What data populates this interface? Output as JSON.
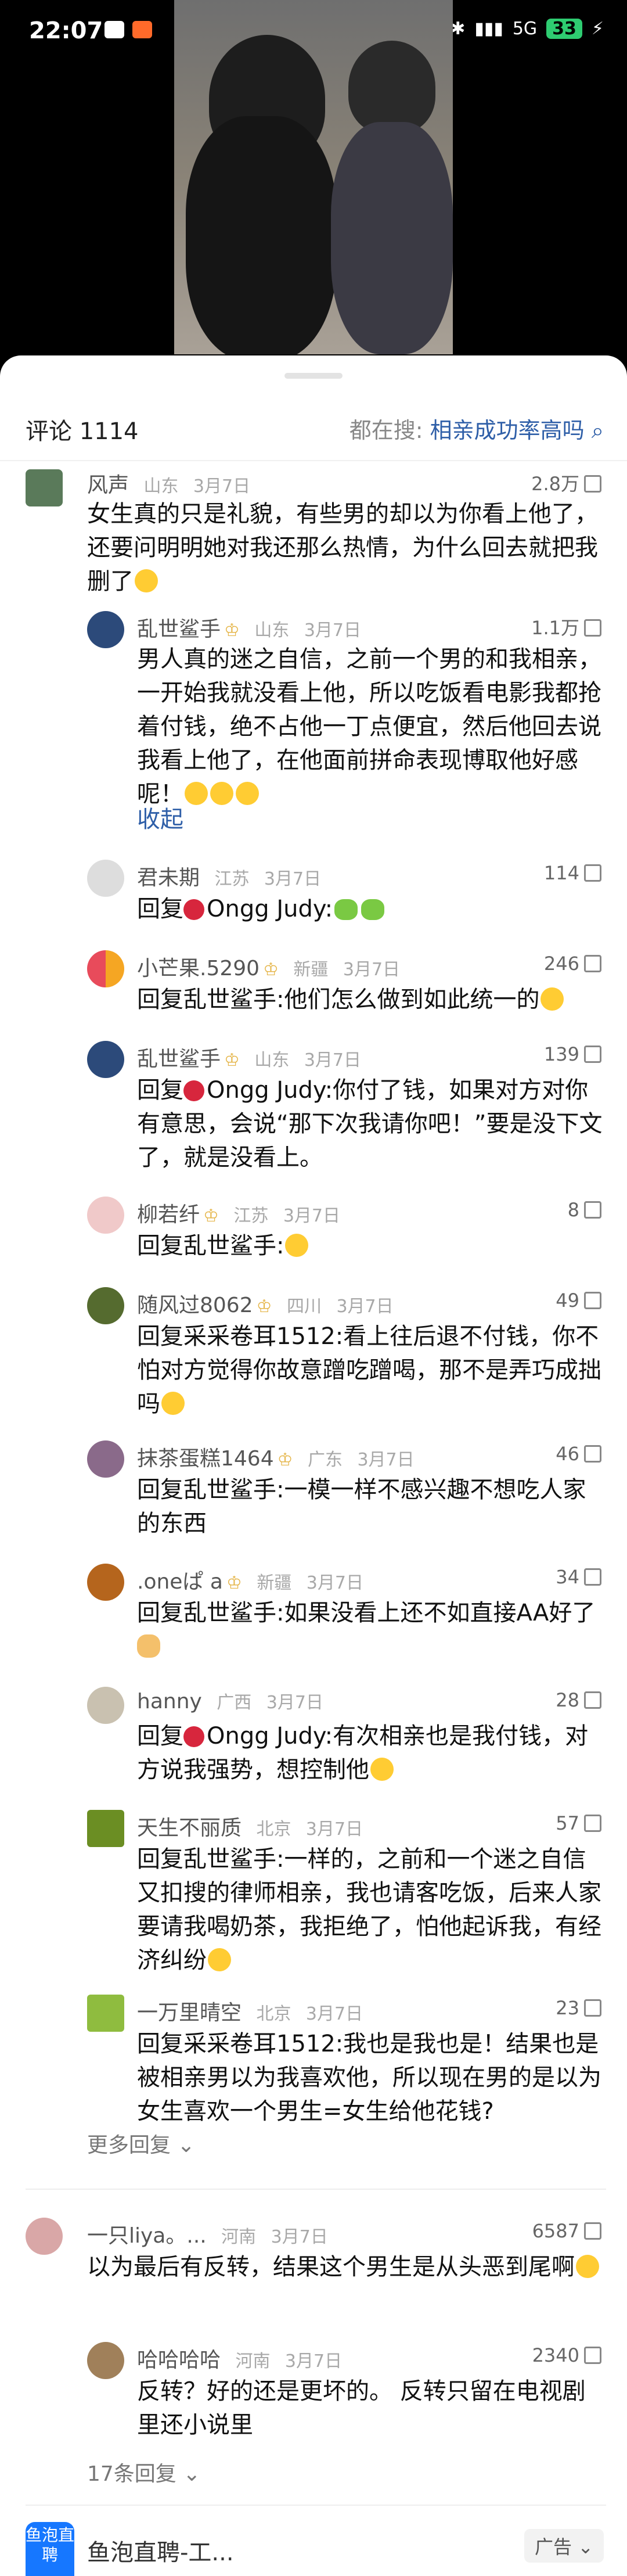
{
  "status_bar": {
    "time": "22:07",
    "network": "5G",
    "battery": "33"
  },
  "header": {
    "comment_label": "评论 1114",
    "search_label": "都在搜:",
    "search_query": "相亲成功率高吗",
    "search_icon": "search-icon"
  },
  "comments": [
    {
      "name": "风声",
      "location": "山东",
      "date": "3月7日",
      "likes": "2.8万",
      "text": "女生真的只是礼貌，有些男的却以为你看上他了，还要问明明她对我还那么热情，为什么回去就把我删了"
    },
    {
      "name": "乱世鲨手",
      "badge": "VIP",
      "location": "山东",
      "date": "3月7日",
      "likes": "1.1万",
      "text": "男人真的迷之自信，之前一个男的和我相亲，一开始我就没看上他，所以吃饭看电影我都抢着付钱，绝不占他一丁点便宜，然后他回去说我看上他了，在他面前拼命表现博取他好感呢！",
      "collapse": "收起"
    },
    {
      "name": "君未期",
      "location": "江苏",
      "date": "3月7日",
      "likes": "114",
      "reply_prefix": "回复",
      "reply_to": "Ongg Judy",
      "text": ":"
    },
    {
      "name": "小芒果.5290",
      "badge": "VIP",
      "location": "新疆",
      "date": "3月7日",
      "likes": "246",
      "reply_prefix": "回复",
      "reply_to": "乱世鲨手",
      "text": ":他们怎么做到如此统一的"
    },
    {
      "name": "乱世鲨手",
      "badge": "VIP",
      "location": "山东",
      "date": "3月7日",
      "likes": "139",
      "reply_prefix": "回复",
      "reply_to": "Ongg Judy",
      "text": ":你付了钱，如果对方对你有意思，会说“那下次我请你吧！”要是没下文了，就是没看上。"
    },
    {
      "name": "柳若纤",
      "badge": "VIP",
      "location": "江苏",
      "date": "3月7日",
      "likes": "8",
      "reply_prefix": "回复",
      "reply_to": "乱世鲨手",
      "text": ":"
    },
    {
      "name": "随风过8062",
      "badge": "VIP",
      "location": "四川",
      "date": "3月7日",
      "likes": "49",
      "reply_prefix": "回复",
      "reply_to": "采采卷耳1512",
      "text": ":看上往后退不付钱，你不怕对方觉得你故意蹭吃蹭喝，那不是弄巧成拙吗"
    },
    {
      "name": "抹茶蛋糕1464",
      "badge": "VIP",
      "location": "广东",
      "date": "3月7日",
      "likes": "46",
      "reply_prefix": "回复",
      "reply_to": "乱世鲨手",
      "text": ":一模一样不感兴趣不想吃人家的东西"
    },
    {
      "name": ".oneぱ a",
      "badge": "VIP",
      "location": "新疆",
      "date": "3月7日",
      "likes": "34",
      "reply_prefix": "回复",
      "reply_to": "乱世鲨手",
      "text": ":如果没看上还不如直接AA好了"
    },
    {
      "name": "hanny",
      "location": "广西",
      "date": "3月7日",
      "likes": "28",
      "reply_prefix": "回复",
      "reply_to": "Ongg Judy",
      "text": ":有次相亲也是我付钱，对方说我强势，想控制他"
    },
    {
      "name": "天生不丽质",
      "location": "北京",
      "date": "3月7日",
      "likes": "57",
      "reply_prefix": "回复",
      "reply_to": "乱世鲨手",
      "text": ":一样的，之前和一个迷之自信又扣搜的律师相亲，我也请客吃饭，后来人家要请我喝奶茶，我拒绝了，怕他起诉我，有经济纠纷"
    },
    {
      "name": "一万里晴空",
      "location": "北京",
      "date": "3月7日",
      "likes": "23",
      "reply_prefix": "回复",
      "reply_to": "采采卷耳1512",
      "text": ":我也是我也是！结果也是被相亲男以为我喜欢他，所以现在男的是以为女生喜欢一个男生=女生给他花钱?"
    },
    {
      "name": "一只liya。...",
      "location": "河南",
      "date": "3月7日",
      "likes": "6587",
      "text": "以为最后有反转，结果这个男生是从头恶到尾啊"
    },
    {
      "name": "哈哈哈哈",
      "location": "河南",
      "date": "3月7日",
      "likes": "2340",
      "text": "反转？好的还是更坏的。 反转只留在电视剧里还小说里"
    }
  ],
  "more_replies": "更多回复",
  "reply_count": "17条回复",
  "ad": {
    "logo_text": "鱼泡直聘",
    "title": "鱼泡直聘-工...",
    "tag": "广告"
  }
}
